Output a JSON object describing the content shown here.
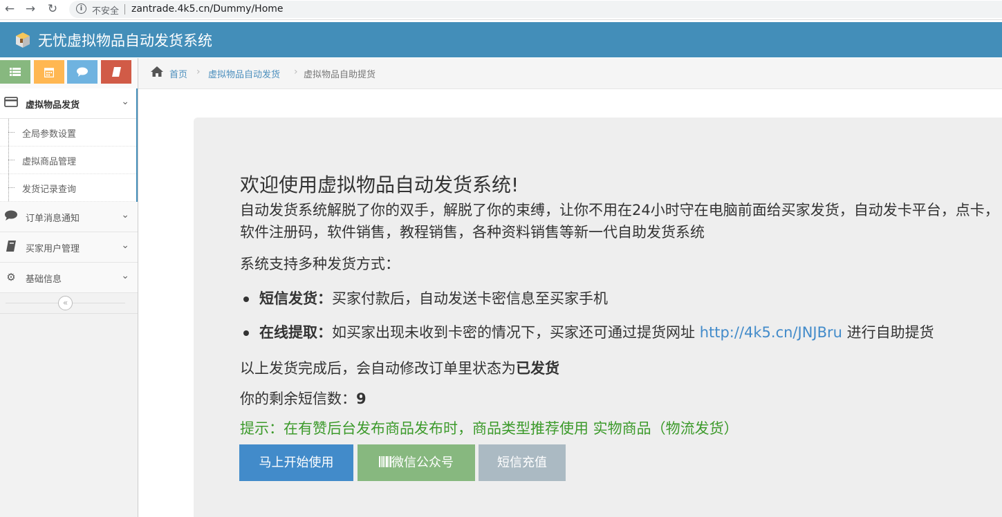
{
  "browser": {
    "insecure_label": "不安全",
    "url": "zantrade.4k5.cn/Dummy/Home"
  },
  "app": {
    "title": "无忧虚拟物品自动发货系统"
  },
  "sidebar": {
    "menus": [
      {
        "label": "虚拟物品发货",
        "icon": "credit-card-icon",
        "expanded": true,
        "children": [
          "全局参数设置",
          "虚拟商品管理",
          "发货记录查询"
        ]
      },
      {
        "label": "订单消息通知",
        "icon": "comment-icon"
      },
      {
        "label": "买家用户管理",
        "icon": "book-icon"
      },
      {
        "label": "基础信息",
        "icon": "gear-icon"
      }
    ]
  },
  "breadcrumb": {
    "home": "首页",
    "level1": "虚拟物品自动发货",
    "current": "虚拟物品自助提货"
  },
  "main": {
    "title": "欢迎使用虚拟物品自动发货系统!",
    "intro": "自动发货系统解脱了你的双手，解脱了你的束缚，让你不用在24小时守在电脑前面给买家发货，自动发卡平台，点卡，软件注册码，软件销售，教程销售，各种资料销售等新一代自助发货系统",
    "support": "系统支持多种发货方式：",
    "bullets": [
      {
        "label": "短信发货：",
        "text": "买家付款后，自动发送卡密信息至买家手机"
      },
      {
        "label": "在线提取：",
        "text": "如买家出现未收到卡密的情况下，买家还可通过提货网址",
        "link": "http://4k5.cn/JNJBru",
        "text_after": "进行自助提货"
      }
    ],
    "done_prefix": "以上发货完成后，会自动修改订单里状态为",
    "done_status": "已发货",
    "sms_label": "你的剩余短信数：",
    "sms_count": "9",
    "tip": "提示：在有赞后台发布商品发布时，商品类型推荐使用 实物商品（物流发货）",
    "buttons": {
      "start": "马上开始使用",
      "wechat": "微信公众号",
      "sms_recharge": "短信充值"
    }
  }
}
